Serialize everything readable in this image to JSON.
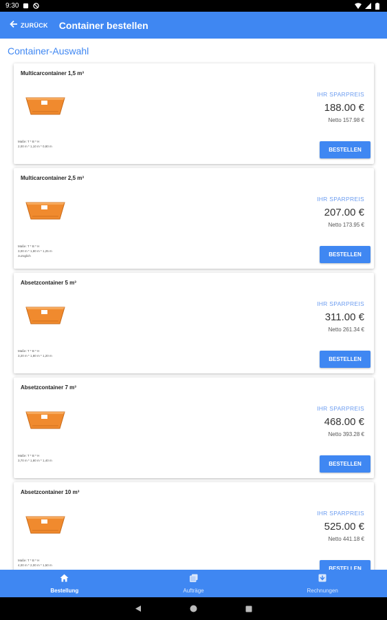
{
  "status_bar": {
    "time": "9:30"
  },
  "app_bar": {
    "back_label": "ZURÜCK",
    "title": "Container bestellen"
  },
  "section_title": "Container-Auswahl",
  "cards": [
    {
      "title": "Multicarcontainer 1,5 m³",
      "dims_label": "Maße: T * B * H",
      "dims_value": "2,00 m * 1,10 m * 0,80 m",
      "dims_extra": "",
      "price_label": "IHR SPARPREIS",
      "price": "188.00 €",
      "netto": "Netto 157.98 €",
      "button": "BESTELLEN"
    },
    {
      "title": "Multicarcontainer 2,5 m³",
      "dims_label": "Maße: T * B * H",
      "dims_value": "3,00 m * 1,80 m * 1,25 m",
      "dims_extra": "zuzüglich",
      "price_label": "IHR SPARPREIS",
      "price": "207.00 €",
      "netto": "Netto 173.95 €",
      "button": "BESTELLEN"
    },
    {
      "title": "Absetzcontainer 5 m³",
      "dims_label": "Maße: T * B * H",
      "dims_value": "3,20 m * 1,80 m * 1,20 m",
      "dims_extra": "",
      "price_label": "IHR SPARPREIS",
      "price": "311.00 €",
      "netto": "Netto 261.34 €",
      "button": "BESTELLEN"
    },
    {
      "title": "Absetzcontainer 7 m³",
      "dims_label": "Maße: T * B * H",
      "dims_value": "3,70 m * 1,80 m * 1,40 m",
      "dims_extra": "",
      "price_label": "IHR SPARPREIS",
      "price": "468.00 €",
      "netto": "Netto 393.28 €",
      "button": "BESTELLEN"
    },
    {
      "title": "Absetzcontainer 10 m³",
      "dims_label": "Maße: T * B * H",
      "dims_value": "4,00 m * 2,00 m * 1,50 m",
      "dims_extra": "",
      "price_label": "IHR SPARPREIS",
      "price": "525.00 €",
      "netto": "Netto 441.18 €",
      "button": "BESTELLEN"
    }
  ],
  "bottom_nav": [
    {
      "label": "Bestellung",
      "icon": "home-icon",
      "active": true
    },
    {
      "label": "Aufträge",
      "icon": "orders-icon",
      "active": false
    },
    {
      "label": "Rechnungen",
      "icon": "invoice-icon",
      "active": false
    }
  ],
  "colors": {
    "primary": "#3f87f2",
    "container_orange": "#f08a2e",
    "price_label": "#6b9cf0"
  }
}
